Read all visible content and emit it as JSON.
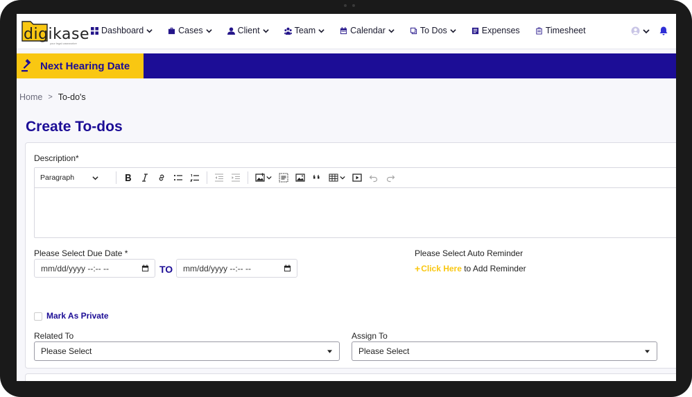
{
  "brand": {
    "name": "digikase",
    "tagline": "your legal caseworker"
  },
  "nav": {
    "items": [
      {
        "label": "Dashboard",
        "icon": "dashboard-icon",
        "dropdown": true
      },
      {
        "label": "Cases",
        "icon": "briefcase-icon",
        "dropdown": true
      },
      {
        "label": "Client",
        "icon": "user-icon",
        "dropdown": true
      },
      {
        "label": "Team",
        "icon": "team-icon",
        "dropdown": true
      },
      {
        "label": "Calendar",
        "icon": "calendar-icon",
        "dropdown": true
      },
      {
        "label": "To Dos",
        "icon": "todo-icon",
        "dropdown": true
      },
      {
        "label": "Expenses",
        "icon": "expenses-icon",
        "dropdown": false
      },
      {
        "label": "Timesheet",
        "icon": "clipboard-icon",
        "dropdown": false
      }
    ]
  },
  "hearing": {
    "label": "Next Hearing Date"
  },
  "breadcrumb": {
    "home": "Home",
    "separator": ">",
    "current": "To-do's"
  },
  "page": {
    "title": "Create To-dos"
  },
  "form": {
    "description_label": "Description*",
    "editor": {
      "paragraph_label": "Paragraph"
    },
    "due_date_label": "Please Select Due Date *",
    "date_from_placeholder": "mm/dd/yyyy --:-- --",
    "date_to_placeholder": "mm/dd/yyyy --:-- --",
    "to_label": "TO",
    "reminder_label": "Please Select Auto Reminder",
    "reminder_plus": "+",
    "reminder_link": "Click Here",
    "reminder_suffix": " to Add Reminder",
    "private_label": "Mark As Private",
    "related_label": "Related To",
    "related_value": "Please Select",
    "assign_label": "Assign To",
    "assign_value": "Please Select"
  },
  "colors": {
    "primary": "#1c0d96",
    "accent": "#f9c712"
  }
}
